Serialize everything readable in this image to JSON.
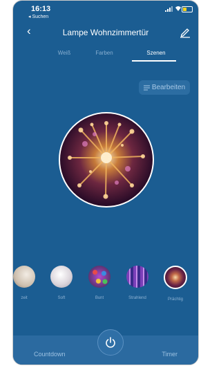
{
  "status_bar": {
    "time": "16:13",
    "back_app": "◂ Suchen"
  },
  "header": {
    "title": "Lampe Wohnzimmertür"
  },
  "tabs": [
    {
      "label": "Weiß",
      "active": false
    },
    {
      "label": "Farben",
      "active": false
    },
    {
      "label": "Szenen",
      "active": true
    }
  ],
  "edit_button": {
    "label": "Bearbeiten"
  },
  "scenes": [
    {
      "label": "zeit",
      "icon": "scene-thumbnail-icon",
      "selected": false
    },
    {
      "label": "Soft",
      "icon": "scene-thumbnail-icon",
      "selected": false
    },
    {
      "label": "Bunt",
      "icon": "scene-thumbnail-icon",
      "selected": false
    },
    {
      "label": "Strahlend",
      "icon": "scene-thumbnail-icon",
      "selected": false
    },
    {
      "label": "Prächtig",
      "icon": "scene-thumbnail-icon",
      "selected": true
    }
  ],
  "bottom_bar": {
    "countdown_label": "Countdown",
    "timer_label": "Timer"
  },
  "colors": {
    "background": "#1b5d92",
    "bottom_bar": "#2b6aa0",
    "tab_inactive": "#87aed0",
    "text": "#ffffff"
  }
}
